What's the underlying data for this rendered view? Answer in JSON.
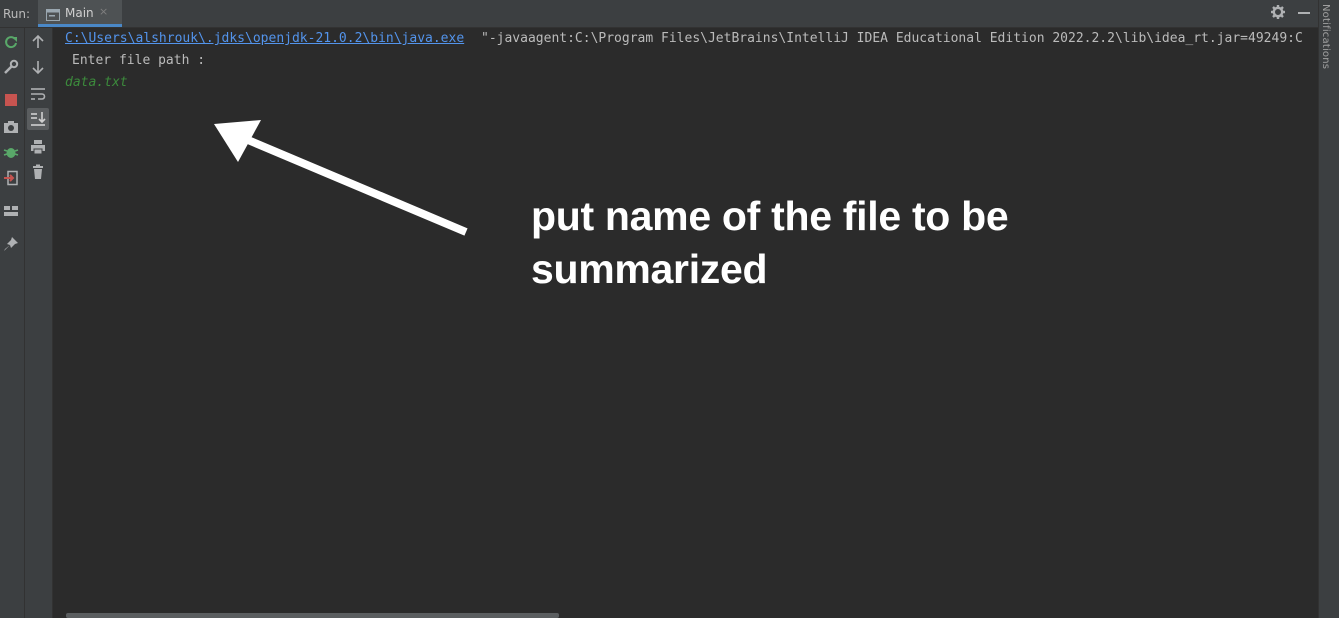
{
  "header": {
    "run_label": "Run:",
    "tab_label": "Main",
    "tab_close": "×"
  },
  "left_toolbar_primary": [
    {
      "icon": "rerun-icon"
    },
    {
      "icon": "wrench-icon"
    },
    {
      "icon": "stop-icon"
    },
    {
      "icon": "camera-icon"
    },
    {
      "icon": "debug-bug-icon"
    },
    {
      "icon": "exit-icon"
    },
    {
      "icon": "layout-icon"
    },
    {
      "icon": "pin-icon"
    }
  ],
  "left_toolbar_secondary": [
    {
      "icon": "arrow-up-icon"
    },
    {
      "icon": "arrow-down-icon"
    },
    {
      "icon": "soft-wrap-icon"
    },
    {
      "icon": "scroll-to-end-icon"
    },
    {
      "icon": "print-icon"
    },
    {
      "icon": "trash-icon"
    }
  ],
  "console": {
    "command_path": "C:\\Users\\alshrouk\\.jdks\\openjdk-21.0.2\\bin\\java.exe",
    "command_args": "\"-javaagent:C:\\Program Files\\JetBrains\\IntelliJ IDEA Educational Edition 2022.2.2\\lib\\idea_rt.jar=49249:C",
    "prompt": "Enter file path :",
    "user_input": "data.txt"
  },
  "right_strip": {
    "label": "Notifications"
  },
  "annotation": {
    "line1": "put name of the file to be",
    "line2": "summarized"
  },
  "colors": {
    "console_bg": "#2b2b2b",
    "panel_bg": "#3c3f41",
    "link": "#5394ec",
    "input_green": "#3c8a3c",
    "stop_red": "#c75450",
    "rerun_green": "#59a869"
  }
}
